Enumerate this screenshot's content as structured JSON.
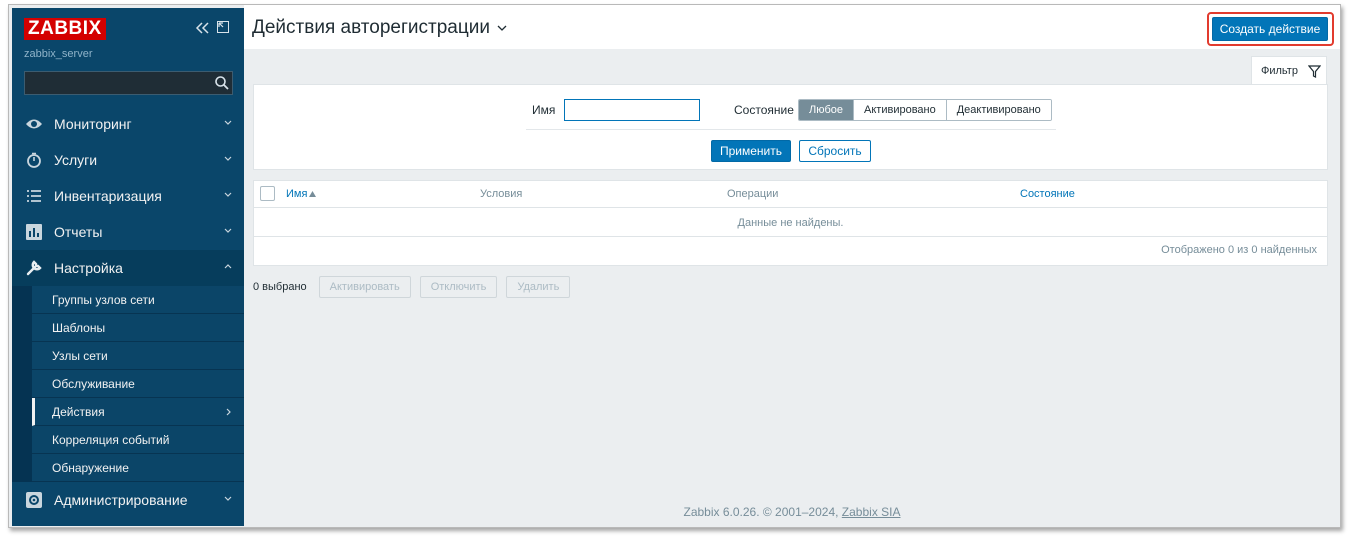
{
  "sidebar": {
    "logo": "ZABBIX",
    "server_name": "zabbix_server",
    "search_placeholder": "",
    "menu": [
      {
        "label": "Мониторинг",
        "icon": "eye-icon"
      },
      {
        "label": "Услуги",
        "icon": "clock-icon"
      },
      {
        "label": "Инвентаризация",
        "icon": "list-icon"
      },
      {
        "label": "Отчеты",
        "icon": "bar-chart-icon"
      },
      {
        "label": "Настройка",
        "icon": "wrench-icon"
      },
      {
        "label": "Администрирование",
        "icon": "gear-icon"
      }
    ],
    "submenu": [
      {
        "label": "Группы узлов сети"
      },
      {
        "label": "Шаблоны"
      },
      {
        "label": "Узлы сети"
      },
      {
        "label": "Обслуживание"
      },
      {
        "label": "Действия"
      },
      {
        "label": "Корреляция событий"
      },
      {
        "label": "Обнаружение"
      }
    ]
  },
  "header": {
    "title": "Действия авторегистрации",
    "create_button": "Создать действие"
  },
  "filter": {
    "tab_label": "Фильтр",
    "name_label": "Имя",
    "name_value": "",
    "state_label": "Состояние",
    "state_options": [
      "Любое",
      "Активировано",
      "Деактивировано"
    ],
    "apply_label": "Применить",
    "reset_label": "Сбросить"
  },
  "table": {
    "columns": [
      "Имя",
      "Условия",
      "Операции",
      "Состояние"
    ],
    "empty_text": "Данные не найдены.",
    "count_text": "Отображено 0 из 0 найденных"
  },
  "bulk": {
    "selected": "0 выбрано",
    "activate": "Активировать",
    "disable": "Отключить",
    "delete": "Удалить"
  },
  "footer": {
    "text": "Zabbix 6.0.26. © 2001–2024, ",
    "link": "Zabbix SIA"
  },
  "colors": {
    "sidebar_bg": "#0a466a",
    "accent": "#0275b8",
    "logo_red": "#d40000",
    "highlight": "#e23b2e"
  }
}
